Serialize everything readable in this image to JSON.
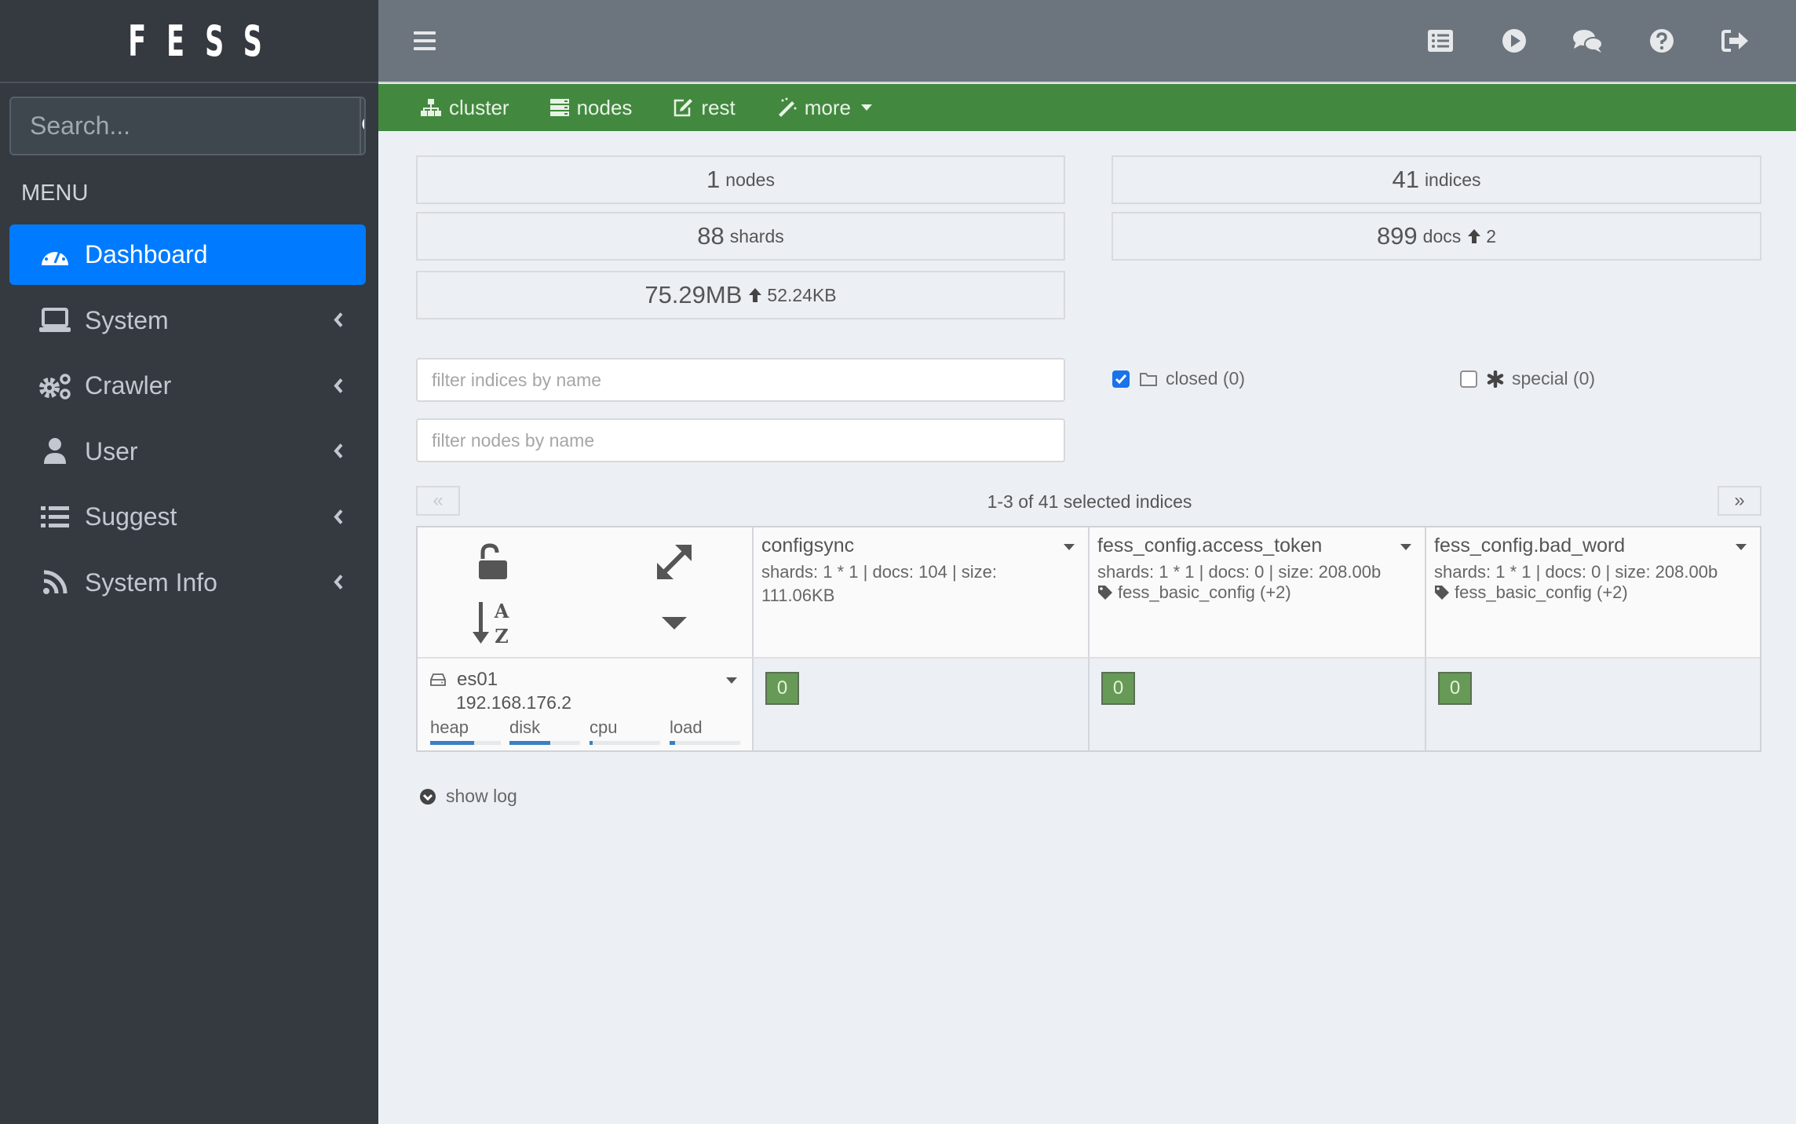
{
  "sidebar": {
    "brand": "FESS",
    "search_placeholder": "Search...",
    "menu_header": "MENU",
    "items": [
      {
        "label": "Dashboard",
        "icon": "tachometer-icon",
        "active": true
      },
      {
        "label": "System",
        "icon": "laptop-icon"
      },
      {
        "label": "Crawler",
        "icon": "cogs-icon"
      },
      {
        "label": "User",
        "icon": "user-icon"
      },
      {
        "label": "Suggest",
        "icon": "list-icon"
      },
      {
        "label": "System Info",
        "icon": "rss-icon"
      }
    ]
  },
  "header": {
    "icons": [
      "list-alt-icon",
      "play-circle-icon",
      "comments-icon",
      "question-circle-icon",
      "sign-out-icon"
    ]
  },
  "toolbar": {
    "items": [
      {
        "label": "cluster",
        "icon": "sitemap-icon"
      },
      {
        "label": "nodes",
        "icon": "server-icon"
      },
      {
        "label": "rest",
        "icon": "edit-icon"
      },
      {
        "label": "more",
        "icon": "magic-icon"
      }
    ]
  },
  "stats": {
    "nodes": {
      "value": "1",
      "unit": "nodes"
    },
    "shards": {
      "value": "88",
      "unit": "shards"
    },
    "size": {
      "value": "75.29MB",
      "delta": "52.24KB"
    },
    "indices": {
      "value": "41",
      "unit": "indices"
    },
    "docs": {
      "value": "899",
      "unit": "docs",
      "delta": "2"
    }
  },
  "filters": {
    "indices_placeholder": "filter indices by name",
    "nodes_placeholder": "filter nodes by name",
    "closed": {
      "label": "closed (0)",
      "checked": true
    },
    "special": {
      "label": "special (0)",
      "checked": false
    }
  },
  "pager": {
    "prev": "«",
    "next": "»",
    "summary": "1-3 of 41 selected indices"
  },
  "indices": [
    {
      "name": "configsync",
      "meta": "shards: 1 * 1 | docs: 104 | size: 111.06KB",
      "alias": "",
      "shard": "0"
    },
    {
      "name": "fess_config.access_token",
      "meta": "shards: 1 * 1 | docs: 0 | size: 208.00b",
      "alias": "fess_basic_config (+2)",
      "shard": "0"
    },
    {
      "name": "fess_config.bad_word",
      "meta": "shards: 1 * 1 | docs: 0 | size: 208.00b",
      "alias": "fess_basic_config (+2)",
      "shard": "0"
    }
  ],
  "node": {
    "name": "es01",
    "ip": "192.168.176.2",
    "metrics": [
      {
        "label": "heap",
        "fraction": 0.62
      },
      {
        "label": "disk",
        "fraction": 0.58
      },
      {
        "label": "cpu",
        "fraction": 0.04
      },
      {
        "label": "load",
        "fraction": 0.08
      }
    ]
  },
  "show_log": "show log",
  "colors": {
    "sidebar_bg": "#343a40",
    "active_item": "#007bff",
    "header_bg": "#6c757d",
    "toolbar_green": "#43883f",
    "shard_green": "#669a56",
    "metric_bar": "#3a7fc4",
    "main_bg": "#ecf0f5"
  }
}
